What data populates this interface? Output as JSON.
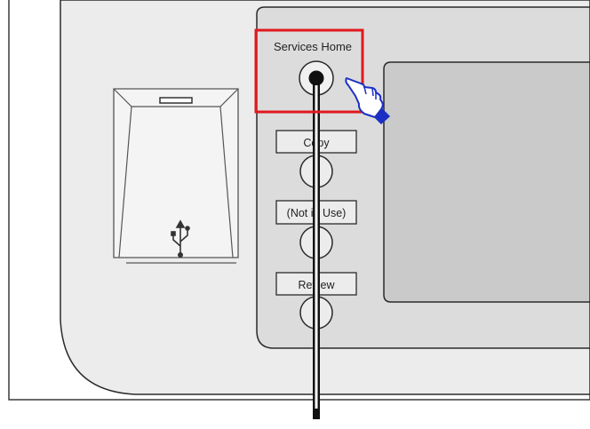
{
  "panel": {
    "buttons": [
      {
        "id": "services-home",
        "label": "Services Home",
        "highlighted": true
      },
      {
        "id": "copy",
        "label": "Copy",
        "highlighted": false
      },
      {
        "id": "not-in-use",
        "label": "(Not in Use)",
        "highlighted": false
      },
      {
        "id": "review",
        "label": "Review",
        "highlighted": false
      }
    ]
  },
  "usb_port": {
    "icon": "usb-icon"
  },
  "touchscreen": {
    "state": "blank"
  },
  "colors": {
    "panel_fill": "#ececec",
    "inner_panel_fill": "#dcdcdc",
    "screen_fill": "#cacaca",
    "highlight": "#e0191e",
    "hand_blue": "#1b2fc4",
    "line": "#1a1a1a"
  },
  "icons": [
    "usb-icon",
    "pointing-hand-icon"
  ]
}
